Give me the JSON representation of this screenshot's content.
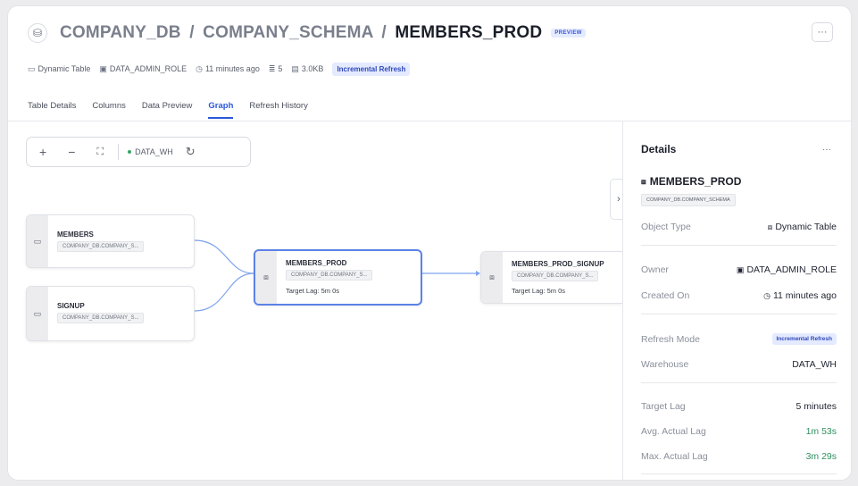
{
  "header": {
    "crumb_db": "COMPANY_DB",
    "crumb_sep1": "/",
    "crumb_schema": "COMPANY_SCHEMA",
    "crumb_sep2": "/",
    "crumb_table": "MEMBERS_PROD",
    "preview_badge": "PREVIEW",
    "more_label": "···"
  },
  "meta": {
    "type": "Dynamic Table",
    "role": "DATA_ADMIN_ROLE",
    "created": "11 minutes ago",
    "rows": "5",
    "size": "3.0KB",
    "refresh_badge": "Incremental Refresh"
  },
  "tabs": [
    {
      "label": "Table Details"
    },
    {
      "label": "Columns"
    },
    {
      "label": "Data Preview"
    },
    {
      "label": "Graph"
    },
    {
      "label": "Refresh History"
    }
  ],
  "toolbar": {
    "zoom_in": "+",
    "zoom_out": "−",
    "fit": "⛶",
    "warehouse": "DATA_WH",
    "refresh": "↻"
  },
  "nodes": {
    "members": {
      "title": "MEMBERS",
      "schema": "COMPANY_DB.COMPANY_S..."
    },
    "signup": {
      "title": "SIGNUP",
      "schema": "COMPANY_DB.COMPANY_S..."
    },
    "members_prod": {
      "title": "MEMBERS_PROD",
      "schema": "COMPANY_DB.COMPANY_S...",
      "lag": "Target Lag: 5m 0s"
    },
    "members_prod_signup": {
      "title": "MEMBERS_PROD_SIGNUP",
      "schema": "COMPANY_DB.COMPANY_S...",
      "lag": "Target Lag: 5m 0s"
    }
  },
  "expand_label": "›",
  "details": {
    "title": "Details",
    "more": "···",
    "name": "MEMBERS_PROD",
    "schema": "COMPANY_DB.COMPANY_SCHEMA",
    "object_type_label": "Object Type",
    "object_type_value": "Dynamic Table",
    "owner_label": "Owner",
    "owner_value": "DATA_ADMIN_ROLE",
    "created_label": "Created On",
    "created_value": "11 minutes ago",
    "refresh_mode_label": "Refresh Mode",
    "refresh_mode_value": "Incremental Refresh",
    "warehouse_label": "Warehouse",
    "warehouse_value": "DATA_WH",
    "target_lag_label": "Target Lag",
    "target_lag_value": "5 minutes",
    "avg_lag_label": "Avg. Actual Lag",
    "avg_lag_value": "1m 53s",
    "max_lag_label": "Max. Actual Lag",
    "max_lag_value": "3m 29s"
  },
  "colors": {
    "accent": "#2a59d8",
    "badge_bg": "#e4eaff",
    "green": "#2f8f5f",
    "edge": "#7ea2ee"
  }
}
